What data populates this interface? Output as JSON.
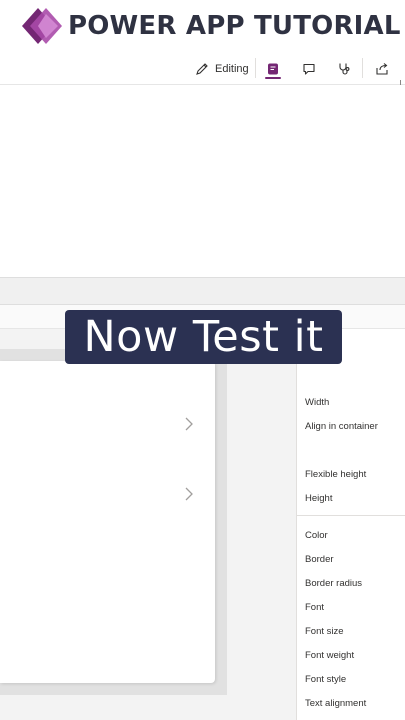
{
  "banner": {
    "title": "POWER APP TUTORIAL",
    "logo_icon": "power-apps-logo",
    "colors": {
      "logo_dark": "#742774",
      "logo_light": "#c36bc3",
      "title": "#2f3242"
    }
  },
  "command_bar": {
    "editing_label": "Editing",
    "icons": [
      "pencil-icon",
      "app-checker-icon",
      "comment-icon",
      "stethoscope-icon",
      "share-icon"
    ],
    "accent": "#742774"
  },
  "caption": {
    "text": "Now Test it",
    "background": "#2b3152"
  },
  "properties": {
    "group1": [
      "Width",
      "Align in container",
      "Flexible height",
      "Height"
    ],
    "group2": [
      "Color",
      "Border",
      "Border radius",
      "Font",
      "Font size",
      "Font weight",
      "Font style",
      "Text alignment"
    ]
  }
}
